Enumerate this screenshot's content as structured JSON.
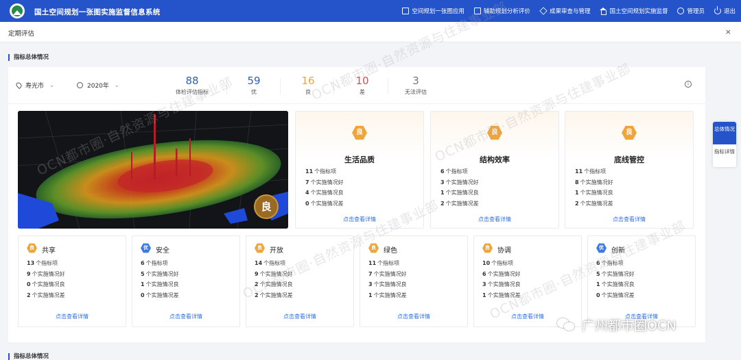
{
  "header": {
    "title": "国土空间规划一张图实施监督信息系统",
    "nav": [
      {
        "label": "空间规划一张图应用",
        "icon": "map-icon"
      },
      {
        "label": "辅助规划分析评价",
        "icon": "clipboard-icon"
      },
      {
        "label": "成果审查与管理",
        "icon": "cube-icon"
      },
      {
        "label": "国土空间规划实施监督",
        "icon": "building-icon"
      },
      {
        "label": "管理员",
        "icon": "user-icon"
      },
      {
        "label": "退出",
        "icon": "power-icon"
      }
    ]
  },
  "tab": {
    "title": "定期评估",
    "close": "×"
  },
  "section1": {
    "title": "指标总体情况"
  },
  "section2": {
    "title": "指标总体情况"
  },
  "filters": {
    "city": "寿光市",
    "year": "2020年"
  },
  "kpis": [
    {
      "value": "88",
      "label": "体检评估指标",
      "color": "#2f5fb0"
    },
    {
      "value": "59",
      "label": "优",
      "color": "#2f5fb0"
    },
    {
      "value": "16",
      "label": "良",
      "color": "#f0a53a"
    },
    {
      "value": "10",
      "label": "差",
      "color": "#e0484a"
    },
    {
      "value": "3",
      "label": "无法评估",
      "color": "#777777"
    }
  ],
  "map": {
    "badge": "良"
  },
  "big_cards": [
    {
      "grade": "良",
      "title": "生活品质",
      "total": "11",
      "good": "7",
      "fair": "4",
      "poor": "0"
    },
    {
      "grade": "良",
      "title": "结构效率",
      "total": "6",
      "good": "3",
      "fair": "1",
      "poor": "2"
    },
    {
      "grade": "良",
      "title": "底线管控",
      "total": "11",
      "good": "8",
      "fair": "1",
      "poor": "2"
    }
  ],
  "small_cards": [
    {
      "grade": "良",
      "grade_color": "#f0a53a",
      "title": "共享",
      "total": "13",
      "good": "9",
      "fair": "0",
      "poor": "2"
    },
    {
      "grade": "优",
      "grade_color": "#3d7be2",
      "title": "安全",
      "total": "6",
      "good": "5",
      "fair": "1",
      "poor": "0"
    },
    {
      "grade": "良",
      "grade_color": "#f0a53a",
      "title": "开放",
      "total": "14",
      "good": "9",
      "fair": "2",
      "poor": "2"
    },
    {
      "grade": "良",
      "grade_color": "#f0a53a",
      "title": "绿色",
      "total": "11",
      "good": "7",
      "fair": "3",
      "poor": "1"
    },
    {
      "grade": "良",
      "grade_color": "#f0a53a",
      "title": "协调",
      "total": "10",
      "good": "6",
      "fair": "3",
      "poor": "1"
    },
    {
      "grade": "优",
      "grade_color": "#3d7be2",
      "title": "创新",
      "total": "6",
      "good": "5",
      "fair": "1",
      "poor": "0"
    }
  ],
  "labels": {
    "total_suffix": "个指标项",
    "good_suffix": "个实施情况好",
    "fair_suffix": "个实施情况良",
    "poor_suffix": "个实施情况差",
    "more": "点击查看详情"
  },
  "side_tabs": [
    {
      "label": "总体情况",
      "active": true
    },
    {
      "label": "指标详情",
      "active": false
    }
  ],
  "watermark": "OCN都市圈·自然资源与住建事业部",
  "wechat_label": "广州都市圈OCN",
  "colors": {
    "brand": "#2553c9",
    "good": "#f0a53a",
    "excellent": "#3d7be2",
    "poor": "#e0484a",
    "link": "#2f6fe0"
  }
}
